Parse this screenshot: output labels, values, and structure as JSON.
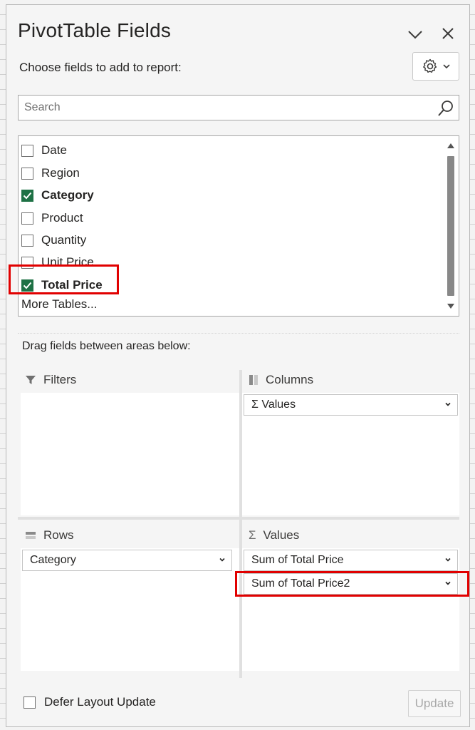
{
  "panel": {
    "title": "PivotTable Fields",
    "choose_label": "Choose fields to add to report:",
    "search_placeholder": "Search"
  },
  "fields": [
    {
      "label": "Date",
      "checked": false
    },
    {
      "label": "Region",
      "checked": false
    },
    {
      "label": "Category",
      "checked": true
    },
    {
      "label": "Product",
      "checked": false
    },
    {
      "label": "Quantity",
      "checked": false
    },
    {
      "label": "Unit Price",
      "checked": false
    },
    {
      "label": "Total Price",
      "checked": true
    }
  ],
  "more_tables": "More Tables...",
  "drag_label": "Drag fields between areas below:",
  "areas": {
    "filters": {
      "label": "Filters",
      "items": []
    },
    "columns": {
      "label": "Columns",
      "items": [
        "Σ Values"
      ]
    },
    "rows": {
      "label": "Rows",
      "items": [
        "Category"
      ]
    },
    "values": {
      "label": "Values",
      "items": [
        "Sum of Total Price",
        "Sum of Total Price2"
      ]
    }
  },
  "footer": {
    "defer_label": "Defer Layout Update",
    "update_label": "Update"
  },
  "colors": {
    "check_green": "#1e7145",
    "highlight_red": "#e10000"
  }
}
